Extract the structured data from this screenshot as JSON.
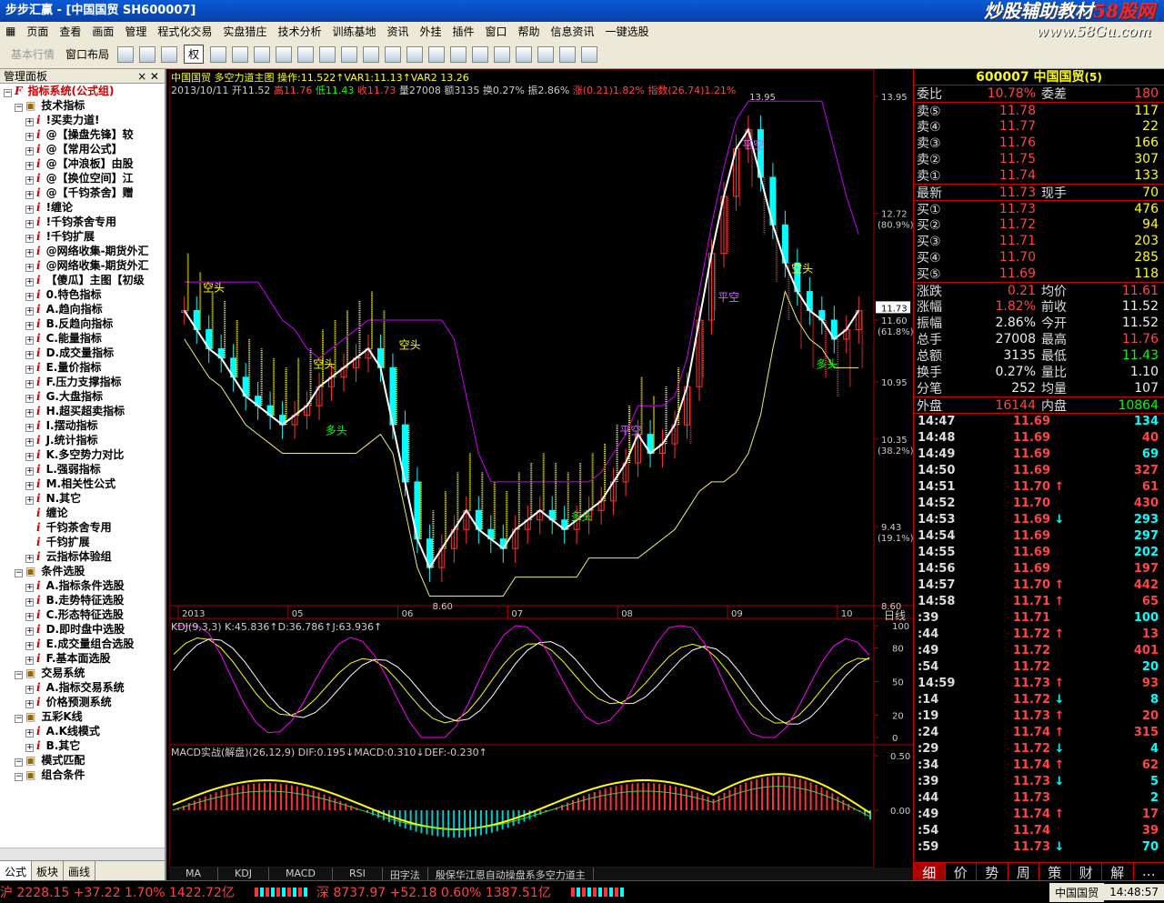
{
  "window": {
    "title": "步步汇赢 - [中国国贸 SH600007]",
    "watermark": "炒股辅助教材",
    "watermark_site": "58股网",
    "watermark_url": "www.58Gu.com"
  },
  "menu": [
    "页面",
    "查看",
    "画面",
    "管理",
    "程式化交易",
    "实盘猎庄",
    "技术分析",
    "训练基地",
    "资讯",
    "外挂",
    "插件",
    "窗口",
    "帮助",
    "信息资讯",
    "一键选股"
  ],
  "toolbar": {
    "label1": "基本行情",
    "label2": "窗口布局",
    "quan": "权"
  },
  "left_panel": {
    "title": "管理面板",
    "close": "× ✕",
    "tree": [
      {
        "t": "指标系统(公式组)",
        "lvl": 0,
        "ic": "F"
      },
      {
        "t": "技术指标",
        "lvl": 1,
        "ic": "box"
      },
      {
        "t": "!买卖力道!",
        "lvl": 2,
        "ic": "i"
      },
      {
        "t": "@【操盘先锋】较",
        "lvl": 2,
        "ic": "i"
      },
      {
        "t": "@【常用公式】",
        "lvl": 2,
        "ic": "i"
      },
      {
        "t": "@【冲浪板】由股",
        "lvl": 2,
        "ic": "i"
      },
      {
        "t": "@【换位空间】江",
        "lvl": 2,
        "ic": "i"
      },
      {
        "t": "@【千钧茶舍】赠",
        "lvl": 2,
        "ic": "i"
      },
      {
        "t": "!缠论",
        "lvl": 2,
        "ic": "i"
      },
      {
        "t": "!千钧茶舍专用",
        "lvl": 2,
        "ic": "i"
      },
      {
        "t": "!千钧扩展",
        "lvl": 2,
        "ic": "i"
      },
      {
        "t": "@网络收集-期货外汇",
        "lvl": 2,
        "ic": "i"
      },
      {
        "t": "@网络收集-期货外汇",
        "lvl": 2,
        "ic": "i"
      },
      {
        "t": "【傻瓜】主图【初级",
        "lvl": 2,
        "ic": "i"
      },
      {
        "t": "0.特色指标",
        "lvl": 2,
        "ic": "i"
      },
      {
        "t": "A.趋向指标",
        "lvl": 2,
        "ic": "i"
      },
      {
        "t": "B.反趋向指标",
        "lvl": 2,
        "ic": "i"
      },
      {
        "t": "C.能量指标",
        "lvl": 2,
        "ic": "i"
      },
      {
        "t": "D.成交量指标",
        "lvl": 2,
        "ic": "i"
      },
      {
        "t": "E.量价指标",
        "lvl": 2,
        "ic": "i"
      },
      {
        "t": "F.压力支撑指标",
        "lvl": 2,
        "ic": "i"
      },
      {
        "t": "G.大盘指标",
        "lvl": 2,
        "ic": "i"
      },
      {
        "t": "H.超买超卖指标",
        "lvl": 2,
        "ic": "i"
      },
      {
        "t": "I.摆动指标",
        "lvl": 2,
        "ic": "i"
      },
      {
        "t": "J.统计指标",
        "lvl": 2,
        "ic": "i"
      },
      {
        "t": "K.多空势力对比",
        "lvl": 2,
        "ic": "i"
      },
      {
        "t": "L.强弱指标",
        "lvl": 2,
        "ic": "i"
      },
      {
        "t": "M.相关性公式",
        "lvl": 2,
        "ic": "i"
      },
      {
        "t": "N.其它",
        "lvl": 2,
        "ic": "i"
      },
      {
        "t": "缠论",
        "lvl": 3,
        "ic": "i"
      },
      {
        "t": "千钧茶舍专用",
        "lvl": 3,
        "ic": "i"
      },
      {
        "t": "千钧扩展",
        "lvl": 3,
        "ic": "i"
      },
      {
        "t": "云指标体验组",
        "lvl": 2,
        "ic": "i"
      },
      {
        "t": "条件选股",
        "lvl": 1,
        "ic": "box"
      },
      {
        "t": "A.指标条件选股",
        "lvl": 2,
        "ic": "i"
      },
      {
        "t": "B.走势特征选股",
        "lvl": 2,
        "ic": "i"
      },
      {
        "t": "C.形态特征选股",
        "lvl": 2,
        "ic": "i"
      },
      {
        "t": "D.即时盘中选股",
        "lvl": 2,
        "ic": "i"
      },
      {
        "t": "E.成交量组合选股",
        "lvl": 2,
        "ic": "i"
      },
      {
        "t": "F.基本面选股",
        "lvl": 2,
        "ic": "i"
      },
      {
        "t": "交易系统",
        "lvl": 1,
        "ic": "box"
      },
      {
        "t": "A.指标交易系统",
        "lvl": 2,
        "ic": "i"
      },
      {
        "t": "价格预测系统",
        "lvl": 2,
        "ic": "i"
      },
      {
        "t": "五彩K线",
        "lvl": 1,
        "ic": "box"
      },
      {
        "t": "A.K线模式",
        "lvl": 2,
        "ic": "i"
      },
      {
        "t": "B.其它",
        "lvl": 2,
        "ic": "i"
      },
      {
        "t": "模式匹配",
        "lvl": 1,
        "ic": "box"
      },
      {
        "t": "组合条件",
        "lvl": 1,
        "ic": "box"
      }
    ],
    "tabs": [
      "公式",
      "板块",
      "画线"
    ]
  },
  "chart_header": {
    "line1": "中国国贸 多空力道主图 操作:11.522↑VAR1:11.13↑VAR2 13.26",
    "date": "2013/10/11",
    "open": "开11.52",
    "high": "高11.76",
    "low": "低11.43",
    "close": "收11.73",
    "vol": "量27008",
    "amt": "额3135",
    "turn": "换0.27%",
    "amp": "振2.86%",
    "chg": "涨(0.21)1.82%",
    "idx": "指数(26.74)1.21%"
  },
  "kdj_header": "KDJ(9,3,3) K:45.836↑D:36.786↑J:63.936↑",
  "macd_header": "MACD实战(解盘)(26,12,9) DIF:0.195↓MACD:0.310↓DEF:-0.230↑",
  "bottom_tabs": [
    "MA",
    "KDJ",
    "MACD",
    "RSI",
    "田字法",
    "殷保华江恩自动操盘系多空力道主"
  ],
  "period_label": "日线",
  "chart_data": [
    {
      "type": "line",
      "name": "main",
      "x_ticks": [
        "2013",
        "05",
        "06",
        "07",
        "08",
        "09",
        "10"
      ],
      "ylim": [
        8.6,
        13.95
      ],
      "y_ticks": [
        13.95,
        12.72,
        11.6,
        10.95,
        10.35,
        9.43,
        8.6
      ],
      "y_pct": {
        "12.72": "(80.9%)",
        "11.60": "(61.8%)",
        "10.35": "(38.2%)",
        "9.43": "(19.1%)"
      },
      "current_price": "11.73",
      "annotations": [
        {
          "text": "空头",
          "color": "#ff0"
        },
        {
          "text": "空头",
          "color": "#ff0"
        },
        {
          "text": "空头",
          "color": "#ff0"
        },
        {
          "text": "多头",
          "color": "#0f0"
        },
        {
          "text": "平空",
          "color": "#c6f"
        },
        {
          "text": "多头",
          "color": "#0f0"
        },
        {
          "text": "平空",
          "color": "#c6f"
        },
        {
          "text": "平空",
          "color": "#c6f"
        },
        {
          "text": "空头",
          "color": "#ff0"
        },
        {
          "text": "多头",
          "color": "#0f0"
        }
      ],
      "high_label": "13.95",
      "low_label": "8.60",
      "close": [
        11.7,
        11.5,
        11.3,
        11.2,
        11.0,
        10.8,
        10.7,
        10.6,
        10.5,
        10.6,
        10.7,
        10.9,
        11.0,
        11.1,
        11.2,
        11.3,
        11.1,
        10.5,
        9.9,
        9.3,
        9.0,
        9.2,
        9.4,
        9.6,
        9.4,
        9.3,
        9.2,
        9.4,
        9.5,
        9.6,
        9.5,
        9.4,
        9.5,
        9.6,
        9.7,
        9.9,
        10.1,
        10.4,
        10.2,
        10.3,
        10.5,
        10.9,
        11.6,
        12.3,
        12.9,
        13.4,
        13.6,
        13.1,
        12.6,
        12.2,
        11.9,
        11.7,
        11.6,
        11.4,
        11.5,
        11.7
      ]
    },
    {
      "type": "line",
      "name": "kdj",
      "y_ticks": [
        100,
        80,
        50,
        20,
        0
      ],
      "series": [
        {
          "name": "K",
          "color": "#fff"
        },
        {
          "name": "D",
          "color": "#ff0"
        },
        {
          "name": "J",
          "color": "#f0f"
        }
      ]
    },
    {
      "type": "bar",
      "name": "macd",
      "y_ticks": [
        0.5,
        0.0
      ]
    }
  ],
  "quote": {
    "code": "600007",
    "name": "中国国贸",
    "suffix": "(5)",
    "weibi": {
      "l": "委比",
      "v": "10.78%",
      "l2": "委差",
      "v2": "180"
    },
    "asks": [
      {
        "l": "卖⑤",
        "p": "11.78",
        "v": "117"
      },
      {
        "l": "卖④",
        "p": "11.77",
        "v": "22"
      },
      {
        "l": "卖③",
        "p": "11.76",
        "v": "166"
      },
      {
        "l": "卖②",
        "p": "11.75",
        "v": "307"
      },
      {
        "l": "卖①",
        "p": "11.74",
        "v": "133"
      }
    ],
    "last": {
      "l": "最新",
      "p": "11.73",
      "l2": "现手",
      "v": "70"
    },
    "bids": [
      {
        "l": "买①",
        "p": "11.73",
        "v": "476"
      },
      {
        "l": "买②",
        "p": "11.72",
        "v": "94"
      },
      {
        "l": "买③",
        "p": "11.71",
        "v": "203"
      },
      {
        "l": "买④",
        "p": "11.70",
        "v": "285"
      },
      {
        "l": "买⑤",
        "p": "11.69",
        "v": "118"
      }
    ],
    "stats": [
      {
        "l": "涨跌",
        "v": "0.21",
        "l2": "均价",
        "v2": "11.61",
        "c": "red",
        "c2": "red"
      },
      {
        "l": "涨幅",
        "v": "1.82%",
        "l2": "前收",
        "v2": "11.52",
        "c": "red",
        "c2": "wht"
      },
      {
        "l": "振幅",
        "v": "2.86%",
        "l2": "今开",
        "v2": "11.52",
        "c": "wht",
        "c2": "wht"
      },
      {
        "l": "总手",
        "v": "27008",
        "l2": "最高",
        "v2": "11.76",
        "c": "wht",
        "c2": "red"
      },
      {
        "l": "总额",
        "v": "3135",
        "l2": "最低",
        "v2": "11.43",
        "c": "wht",
        "c2": "grn"
      },
      {
        "l": "换手",
        "v": "0.27%",
        "l2": "量比",
        "v2": "1.10",
        "c": "wht",
        "c2": "wht"
      },
      {
        "l": "分笔",
        "v": "252",
        "l2": "均量",
        "v2": "107",
        "c": "wht",
        "c2": "wht"
      }
    ],
    "outer": {
      "l": "外盘",
      "v": "16144",
      "l2": "内盘",
      "v2": "10864"
    },
    "ticks": [
      {
        "t": "14:47",
        "p": "11.69",
        "a": "",
        "v": "134",
        "c": "cy"
      },
      {
        "t": "14:48",
        "p": "11.69",
        "a": "",
        "v": "40",
        "c": "red"
      },
      {
        "t": "14:49",
        "p": "11.69",
        "a": "",
        "v": "69",
        "c": "cy"
      },
      {
        "t": "14:50",
        "p": "11.69",
        "a": "",
        "v": "327",
        "c": "red"
      },
      {
        "t": "14:51",
        "p": "11.70",
        "a": "↑",
        "v": "61",
        "c": "red"
      },
      {
        "t": "14:52",
        "p": "11.70",
        "a": "",
        "v": "430",
        "c": "red"
      },
      {
        "t": "14:53",
        "p": "11.69",
        "a": "↓",
        "v": "293",
        "c": "cy"
      },
      {
        "t": "14:54",
        "p": "11.69",
        "a": "",
        "v": "297",
        "c": "cy"
      },
      {
        "t": "14:55",
        "p": "11.69",
        "a": "",
        "v": "202",
        "c": "cy"
      },
      {
        "t": "14:56",
        "p": "11.69",
        "a": "",
        "v": "197",
        "c": "red"
      },
      {
        "t": "14:57",
        "p": "11.70",
        "a": "↑",
        "v": "442",
        "c": "red"
      },
      {
        "t": "14:58",
        "p": "11.71",
        "a": "↑",
        "v": "65",
        "c": "red"
      },
      {
        "t": ":39",
        "p": "11.71",
        "a": "",
        "v": "100",
        "c": "cy"
      },
      {
        "t": ":44",
        "p": "11.72",
        "a": "↑",
        "v": "13",
        "c": "red"
      },
      {
        "t": ":49",
        "p": "11.72",
        "a": "",
        "v": "401",
        "c": "red"
      },
      {
        "t": ":54",
        "p": "11.72",
        "a": "",
        "v": "20",
        "c": "cy"
      },
      {
        "t": "14:59",
        "p": "11.73",
        "a": "↑",
        "v": "93",
        "c": "red"
      },
      {
        "t": ":14",
        "p": "11.72",
        "a": "↓",
        "v": "8",
        "c": "cy"
      },
      {
        "t": ":19",
        "p": "11.73",
        "a": "↑",
        "v": "20",
        "c": "red"
      },
      {
        "t": ":24",
        "p": "11.74",
        "a": "↑",
        "v": "315",
        "c": "red"
      },
      {
        "t": ":29",
        "p": "11.72",
        "a": "↓",
        "v": "4",
        "c": "cy"
      },
      {
        "t": ":34",
        "p": "11.74",
        "a": "↑",
        "v": "62",
        "c": "red"
      },
      {
        "t": ":39",
        "p": "11.73",
        "a": "↓",
        "v": "5",
        "c": "cy"
      },
      {
        "t": ":44",
        "p": "11.73",
        "a": "",
        "v": "2",
        "c": "cy"
      },
      {
        "t": ":49",
        "p": "11.74",
        "a": "↑",
        "v": "17",
        "c": "red"
      },
      {
        "t": ":54",
        "p": "11.74",
        "a": "",
        "v": "39",
        "c": "red"
      },
      {
        "t": ":59",
        "p": "11.73",
        "a": "↓",
        "v": "70",
        "c": "cy"
      }
    ],
    "tabs": [
      "细",
      "价",
      "势",
      "周",
      "策",
      "财",
      "解",
      "…"
    ]
  },
  "status": {
    "sh": "沪 2228.15 +37.22 1.70% 1422.72亿",
    "sz": "深 8737.97 +52.18 0.60% 1387.51亿",
    "ticker": "中国国贸",
    "time": "14:48:57"
  }
}
